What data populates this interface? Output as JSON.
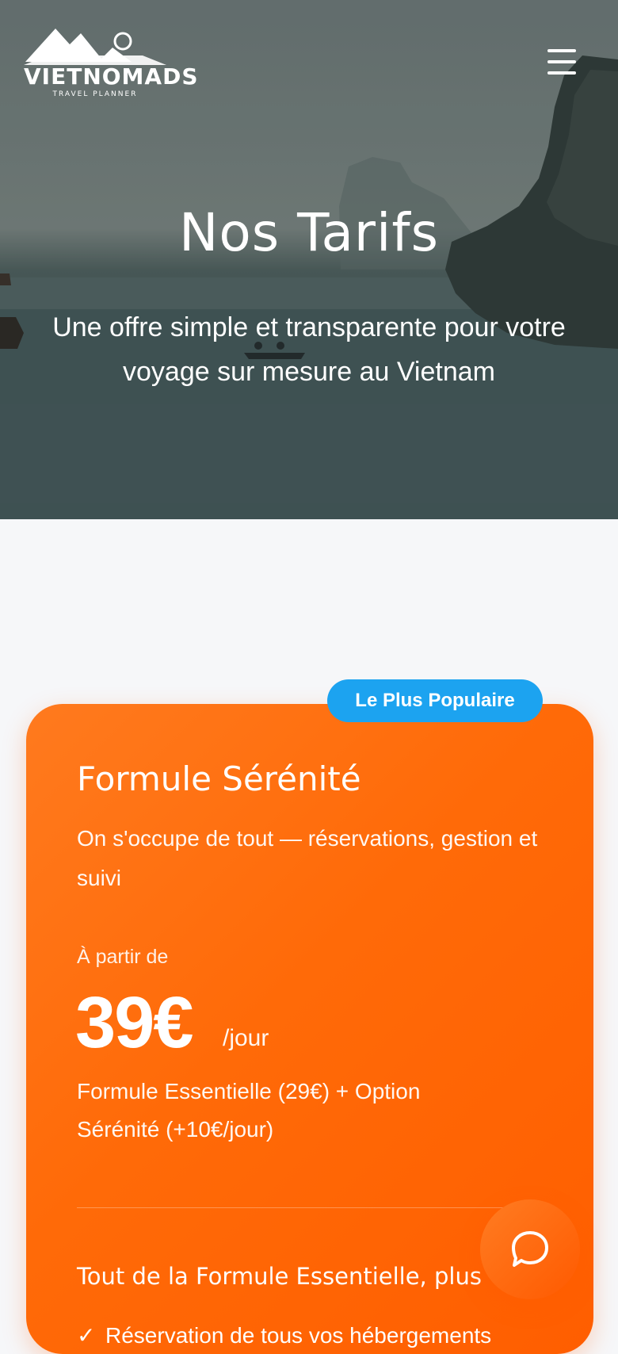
{
  "header": {
    "logo_brand": "VIETNOMADS",
    "logo_tagline": "TRAVEL PLANNER",
    "menu_icon": "hamburger-menu-icon"
  },
  "hero": {
    "title": "Nos Tarifs",
    "subtitle": "Une offre simple et transparente pour votre voyage sur mesure au Vietnam"
  },
  "plan": {
    "badge": "Le Plus Populaire",
    "title": "Formule Sérénité",
    "description": "On s'occupe de tout — réservations, gestion et suivi",
    "from_label": "À partir de",
    "price": "39€",
    "price_unit": "/jour",
    "detail": "Formule Essentielle (29€) + Option Sérénité (+10€/jour)",
    "includes_heading": "Tout de la Formule Essentielle, plus",
    "features": [
      "Réservation de tous vos hébergements"
    ],
    "accent": "#ff6a08",
    "badge_color": "#1ca3f0"
  },
  "chat": {
    "icon": "chat-bubble-icon"
  }
}
